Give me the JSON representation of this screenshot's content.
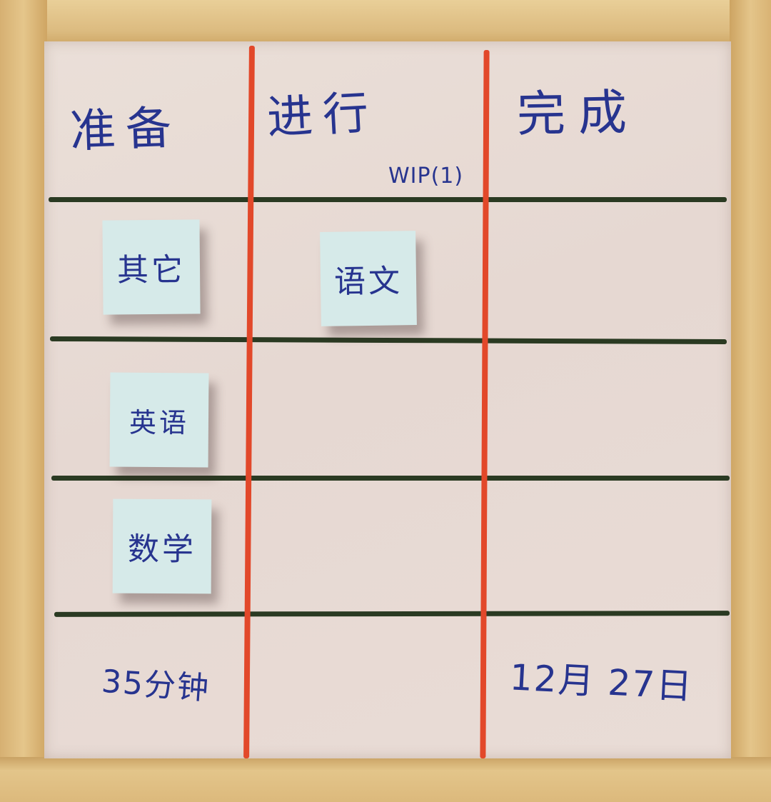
{
  "headers": {
    "todo": "准备",
    "doing": "进行",
    "doing_limit": "WIP(1)",
    "done": "完成"
  },
  "notes": {
    "other": "其它",
    "chinese": "语文",
    "english": "英语",
    "math": "数学"
  },
  "footer": {
    "duration": "35分钟",
    "date": "12月 27日"
  },
  "colors": {
    "marker_ink": "#27348f",
    "column_divider": "#e2482a",
    "row_divider": "#2a3a22",
    "sticky_note": "#d6eae9",
    "board": "#e8dbd5",
    "frame_wood": "#dcb77a"
  }
}
